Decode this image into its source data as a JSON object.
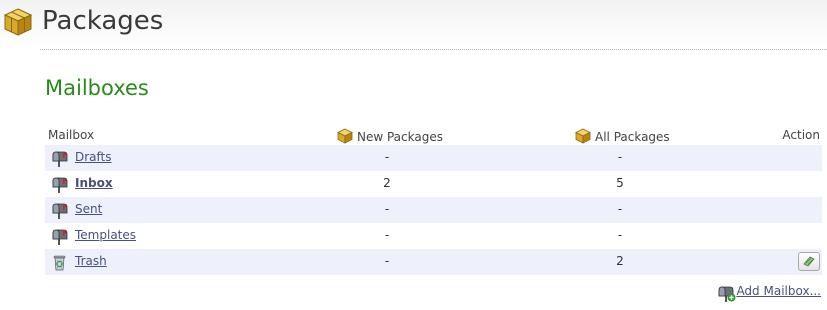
{
  "header": {
    "title": "Packages",
    "icon": "package-box-icon"
  },
  "section": {
    "title": "Mailboxes"
  },
  "table": {
    "columns": {
      "mailbox": "Mailbox",
      "new_packages": "New Packages",
      "all_packages": "All Packages",
      "action": "Action"
    },
    "rows": [
      {
        "name": "Drafts",
        "icon": "mailbox-icon",
        "new": "-",
        "all": "-",
        "bold": false,
        "has_action": false
      },
      {
        "name": "Inbox",
        "icon": "mailbox-icon",
        "new": "2",
        "all": "5",
        "bold": true,
        "has_action": false
      },
      {
        "name": "Sent",
        "icon": "mailbox-icon",
        "new": "-",
        "all": "-",
        "bold": false,
        "has_action": false
      },
      {
        "name": "Templates",
        "icon": "mailbox-icon",
        "new": "-",
        "all": "-",
        "bold": false,
        "has_action": false
      },
      {
        "name": "Trash",
        "icon": "trash-can-icon",
        "new": "-",
        "all": "2",
        "bold": false,
        "has_action": true,
        "action_icon": "empty-trash-icon"
      }
    ]
  },
  "footer": {
    "add_mailbox_label": "Add Mailbox...",
    "add_icon": "add-mailbox-icon"
  },
  "colors": {
    "section_title": "#2a8a1a",
    "link": "#48507f",
    "row_alt": "#eef1fb"
  }
}
